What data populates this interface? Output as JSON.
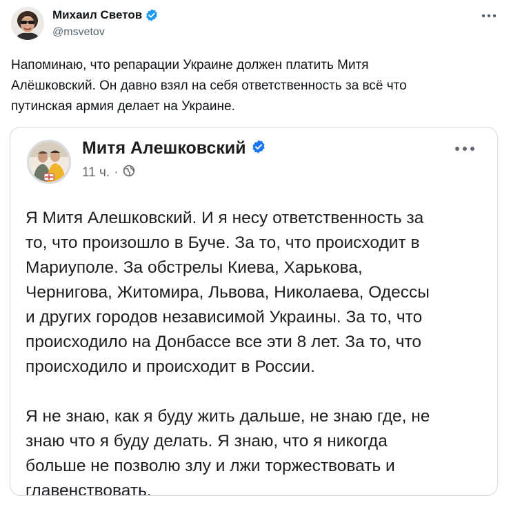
{
  "tweet": {
    "author": {
      "name": "Михаил Светов",
      "handle": "@msvetov",
      "avatar_icon": "user-avatar",
      "verified_icon": "verified-badge-icon",
      "verified_color": "#1d9bf0"
    },
    "more_icon": "more-horizontal-icon",
    "text_lines": [
      "Напоминаю, что репарации Украине должен платить Митя",
      "Алёшковский. Он давно взял на себя ответственность за всё что",
      "путинская армия делает на Украине."
    ]
  },
  "embedded_post": {
    "author": {
      "name": "Митя Алешковский",
      "avatar_icon": "user-avatar",
      "verified_icon": "verified-badge-icon",
      "verified_color": "#1877f2"
    },
    "time": "11 ч.",
    "separator": "·",
    "privacy_icon": "globe-icon",
    "more_icon": "more-horizontal-icon",
    "paragraphs": [
      [
        "Я Митя Алешковский. И я несу ответственность за",
        "то, что произошло в Буче. За то, что происходит в",
        "Мариуполе. За обстрелы Киева, Харькова,",
        "Чернигова, Житомира, Львова, Николаева, Одессы",
        "и других городов независимой Украины. За то, что",
        "происходило на Донбассе все эти 8 лет. За то, что",
        "происходило и происходит в России."
      ],
      [
        "Я не знаю, как я буду жить дальше, не знаю где, не",
        "знаю что я буду делать. Я знаю, что я никогда",
        "больше не позволю злу и лжи торжествовать и",
        "главенствовать."
      ]
    ]
  }
}
